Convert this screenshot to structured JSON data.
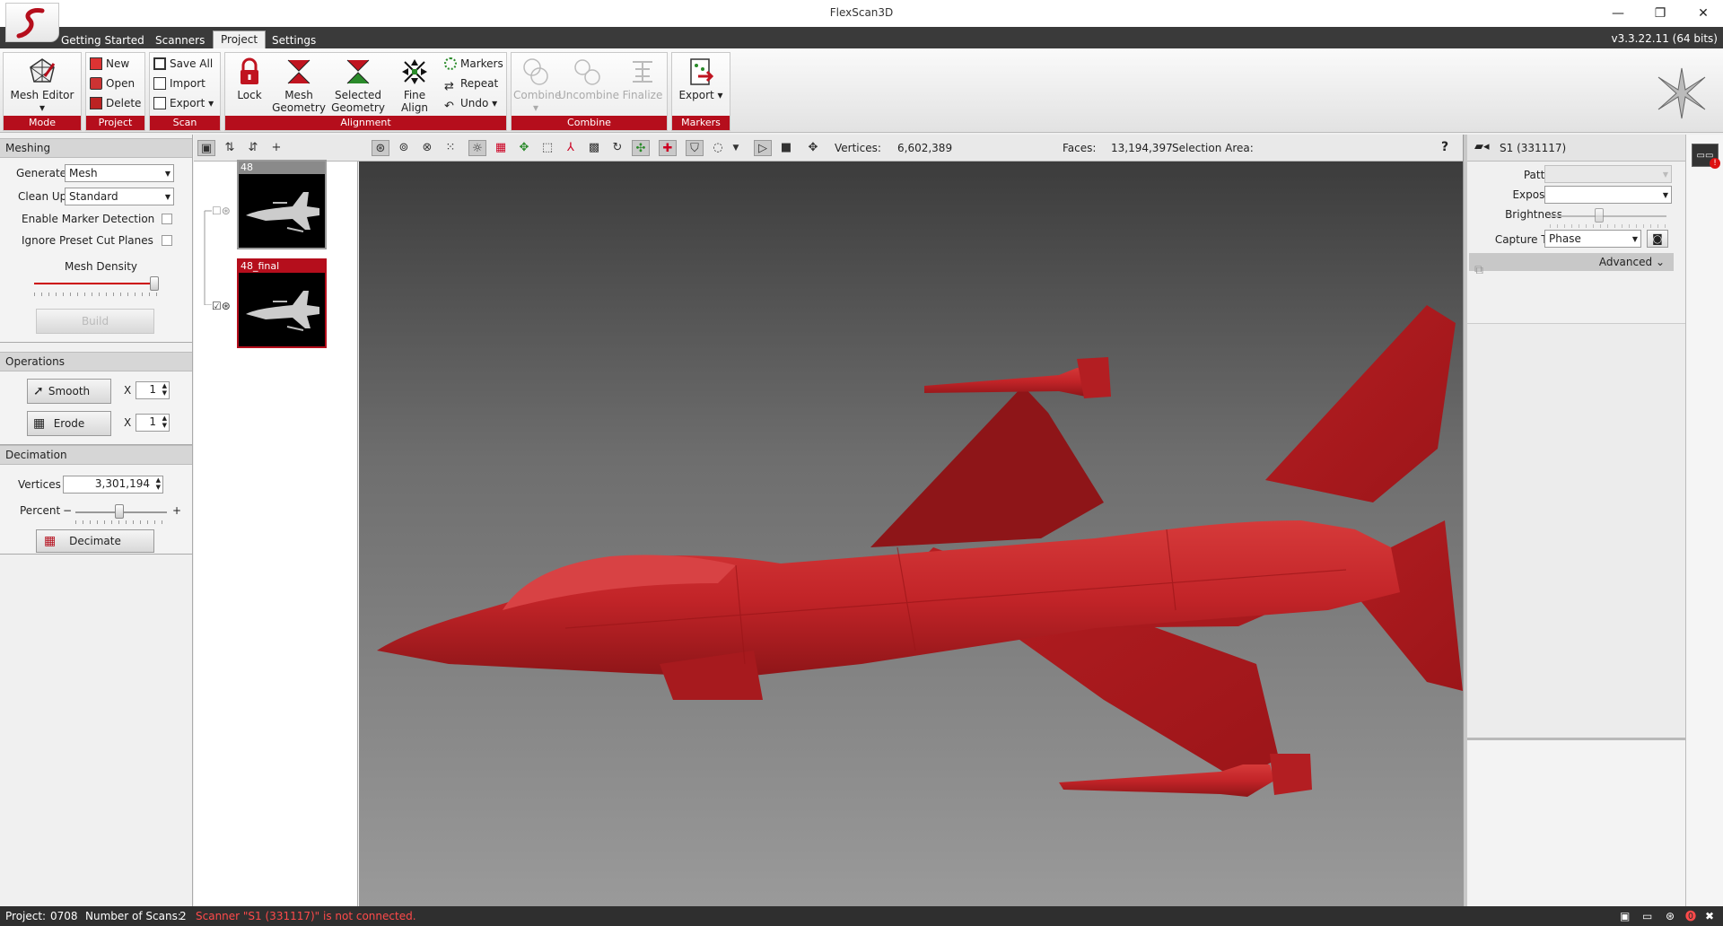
{
  "window": {
    "title": "FlexScan3D",
    "version": "v3.3.22.11  (64 bits)"
  },
  "tabs": [
    {
      "label": "Getting Started"
    },
    {
      "label": "Scanners"
    },
    {
      "label": "Project"
    },
    {
      "label": "Settings"
    }
  ],
  "ribbon": {
    "mode": {
      "label": "Mode",
      "mesh_editor": "Mesh Editor"
    },
    "project": {
      "label": "Project",
      "new": "New",
      "open": "Open",
      "delete": "Delete"
    },
    "scan": {
      "label": "Scan",
      "save_all": "Save All",
      "import": "Import",
      "export": "Export"
    },
    "alignment": {
      "label": "Alignment",
      "lock": "Lock",
      "mesh_geometry_1": "Mesh",
      "mesh_geometry_2": "Geometry",
      "selected_geometry_1": "Selected",
      "selected_geometry_2": "Geometry",
      "fine_align": "Fine Align",
      "markers": "Markers",
      "repeat": "Repeat",
      "undo": "Undo"
    },
    "combine": {
      "label": "Combine",
      "combine": "Combine",
      "uncombine": "Uncombine",
      "finalize": "Finalize"
    },
    "markers": {
      "label": "Markers",
      "export": "Export"
    }
  },
  "meshing": {
    "title": "Meshing",
    "generate_label": "Generate",
    "generate_value": "Mesh",
    "cleanup_label": "Clean Up",
    "cleanup_value": "Standard",
    "enable_marker": "Enable Marker Detection",
    "ignore_preset": "Ignore Preset Cut Planes",
    "mesh_density": "Mesh Density",
    "build": "Build"
  },
  "operations": {
    "title": "Operations",
    "smooth": "Smooth",
    "smooth_x": "X",
    "smooth_count": "1",
    "erode": "Erode",
    "erode_x": "X",
    "erode_count": "1"
  },
  "decimation": {
    "title": "Decimation",
    "vertices_label": "Vertices",
    "vertices_value": "3,301,194",
    "percent_label": "Percent",
    "minus": "−",
    "plus": "+",
    "decimate": "Decimate"
  },
  "scans": [
    {
      "name": "48"
    },
    {
      "name": "48_final"
    }
  ],
  "viewport_stats": {
    "vertices_label": "Vertices:",
    "vertices_value": "6,602,389",
    "faces_label": "Faces:",
    "faces_value": "13,194,397",
    "selection_label": "Selection Area:",
    "help": "?"
  },
  "scanner": {
    "name": "S1 (331117)",
    "pattern_label": "Pattern",
    "exposure_label": "Exposure",
    "brightness_label": "Brightness",
    "capture_test_label": "Capture Test",
    "capture_test_value": "Phase",
    "advanced": "Advanced"
  },
  "status": {
    "project_label": "Project:",
    "project_value": "0708",
    "num_scans_label": "Number of Scans:",
    "num_scans_value": "2",
    "warning": "Scanner \"S1 (331117)\" is not connected."
  },
  "colors": {
    "accent": "#b50e1c",
    "model": "#c8262a"
  }
}
